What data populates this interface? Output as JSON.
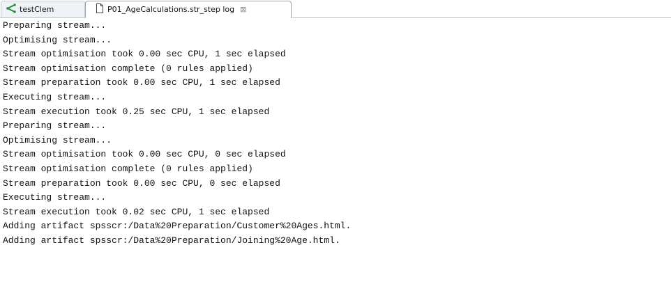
{
  "tabs": [
    {
      "label": "testClem",
      "icon": "stream-icon",
      "active": false
    },
    {
      "label": "P01_AgeCalculations.str_step log",
      "icon": "document-icon",
      "active": true,
      "close_glyph": "⊠"
    }
  ],
  "log_lines": [
    "Preparing stream...",
    "Optimising stream...",
    "Stream optimisation took 0.00 sec CPU, 1 sec elapsed",
    "Stream optimisation complete (0 rules applied)",
    "Stream preparation took 0.00 sec CPU, 1 sec elapsed",
    "Executing stream...",
    "Stream execution took 0.25 sec CPU, 1 sec elapsed",
    "Preparing stream...",
    "Optimising stream...",
    "Stream optimisation took 0.00 sec CPU, 0 sec elapsed",
    "Stream optimisation complete (0 rules applied)",
    "Stream preparation took 0.00 sec CPU, 0 sec elapsed",
    "Executing stream...",
    "Stream execution took 0.02 sec CPU, 1 sec elapsed",
    "Adding artifact spsscr:/Data%20Preparation/Customer%20Ages.html.",
    "Adding artifact spsscr:/Data%20Preparation/Joining%20Age.html."
  ]
}
